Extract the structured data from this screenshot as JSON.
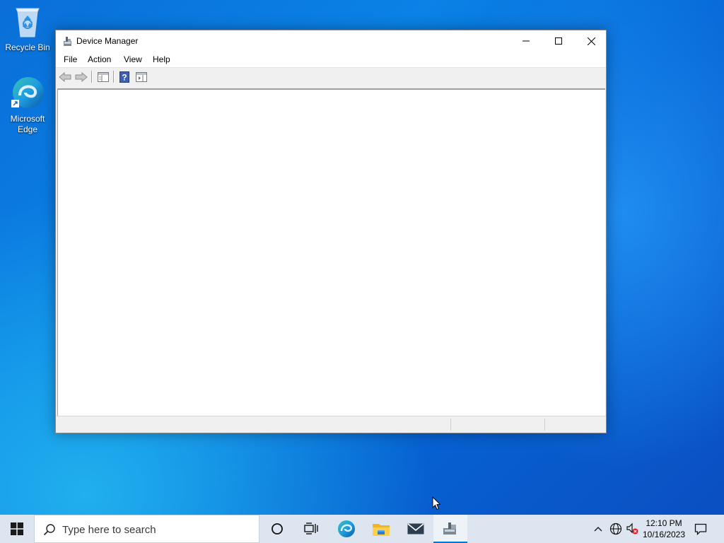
{
  "desktop": {
    "icons": [
      {
        "label": "Recycle Bin",
        "icon": "recycle-bin-icon"
      },
      {
        "label_line1": "Microsoft",
        "label_line2": "Edge",
        "icon": "edge-icon"
      }
    ]
  },
  "window": {
    "title": "Device Manager",
    "icon": "device-manager-icon",
    "controls": [
      "minimize",
      "maximize",
      "close"
    ],
    "menu": [
      "File",
      "Action",
      "View",
      "Help"
    ],
    "toolbar": [
      "back-arrow-icon",
      "forward-arrow-icon",
      "show-hide-console-tree-icon",
      "help-icon",
      "show-hide-action-pane-icon"
    ]
  },
  "taskbar": {
    "search_placeholder": "Type here to search",
    "pinned": [
      "cortana-icon",
      "task-view-icon",
      "edge-icon",
      "file-explorer-icon",
      "mail-icon",
      "device-manager-icon"
    ],
    "clock_time": "12:10 PM",
    "clock_date": "10/16/2023"
  },
  "colors": {
    "accent": "#0078d7",
    "taskbar_bg": "#dde6f0",
    "desktop_blue": "#0a78e0"
  }
}
